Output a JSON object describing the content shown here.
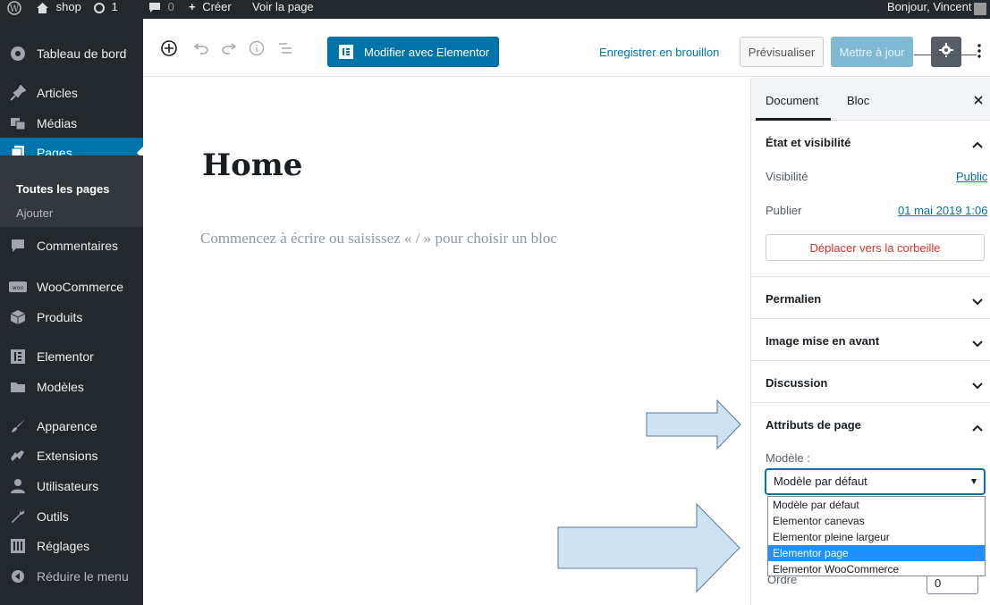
{
  "admin_bar": {
    "site": "shop",
    "updates_count": "1",
    "comments_count": "0",
    "new_label": "Créer",
    "view_page": "Voir la page",
    "greeting": "Bonjour, Vincent"
  },
  "sidebar": {
    "items": [
      {
        "label": "Tableau de bord",
        "icon": "dashboard-icon"
      },
      {
        "label": "Articles",
        "icon": "pin-icon"
      },
      {
        "label": "Médias",
        "icon": "media-icon"
      },
      {
        "label": "Pages",
        "icon": "pages-icon"
      },
      {
        "label": "Commentaires",
        "icon": "comment-icon"
      },
      {
        "label": "WooCommerce",
        "icon": "woocommerce-icon"
      },
      {
        "label": "Produits",
        "icon": "box-icon"
      },
      {
        "label": "Elementor",
        "icon": "elementor-icon"
      },
      {
        "label": "Modèles",
        "icon": "folder-icon"
      },
      {
        "label": "Apparence",
        "icon": "brush-icon"
      },
      {
        "label": "Extensions",
        "icon": "plugin-icon"
      },
      {
        "label": "Utilisateurs",
        "icon": "user-icon"
      },
      {
        "label": "Outils",
        "icon": "wrench-icon"
      },
      {
        "label": "Réglages",
        "icon": "settings-icon"
      },
      {
        "label": "Réduire le menu",
        "icon": "collapse-icon"
      }
    ],
    "submenu": [
      "Toutes les pages",
      "Ajouter"
    ]
  },
  "header": {
    "elementor_button": "Modifier avec Elementor",
    "save_draft": "Enregistrer en brouillon",
    "preview": "Prévisualiser",
    "update": "Mettre à jour"
  },
  "canvas": {
    "title": "Home",
    "placeholder": "Commencez à écrire ou saisissez « / » pour choisir un bloc"
  },
  "panel": {
    "tabs": [
      "Document",
      "Bloc"
    ],
    "status_section": "État et visibilité",
    "visibility_label": "Visibilité",
    "visibility_value": "Public",
    "publish_label": "Publier",
    "publish_value": "01 mai 2019 1:06",
    "trash": "Déplacer vers la corbeille",
    "permalink": "Permalien",
    "featured_image": "Image mise en avant",
    "discussion": "Discussion",
    "page_attributes": "Attributs de page",
    "template_label": "Modèle :",
    "template_selected": "Modèle par défaut",
    "template_options": [
      "Modèle par défaut",
      "Elementor canevas",
      "Elementor pleine largeur",
      "Elementor page",
      "Elementor WooCommerce"
    ],
    "highlighted_option": "Elementor page",
    "order_label": "Ordre",
    "order_value": "0"
  },
  "colors": {
    "admin_dark": "#23282d",
    "accent": "#0073aa",
    "annotation_arrow": "#cfe2f3"
  }
}
